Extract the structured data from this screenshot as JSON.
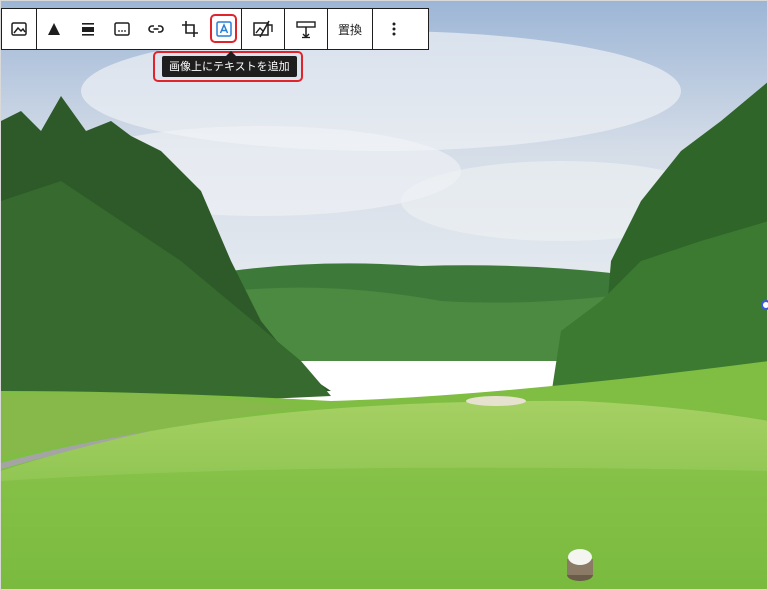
{
  "toolbar": {
    "replace_label": "置換"
  },
  "tooltip": {
    "text": "画像上にテキストを追加"
  },
  "colors": {
    "highlight": "#e0242a",
    "accent_icon": "#2a7fd6",
    "toolbar_border": "#1e1e1e",
    "tooltip_bg": "#1e1e1e"
  },
  "icons": [
    "image-icon",
    "duotone-icon",
    "align-icon",
    "caption-icon",
    "link-icon",
    "crop-icon",
    "text-overlay-icon",
    "remove-bg-icon",
    "dimensions-icon",
    "more-options-icon"
  ]
}
